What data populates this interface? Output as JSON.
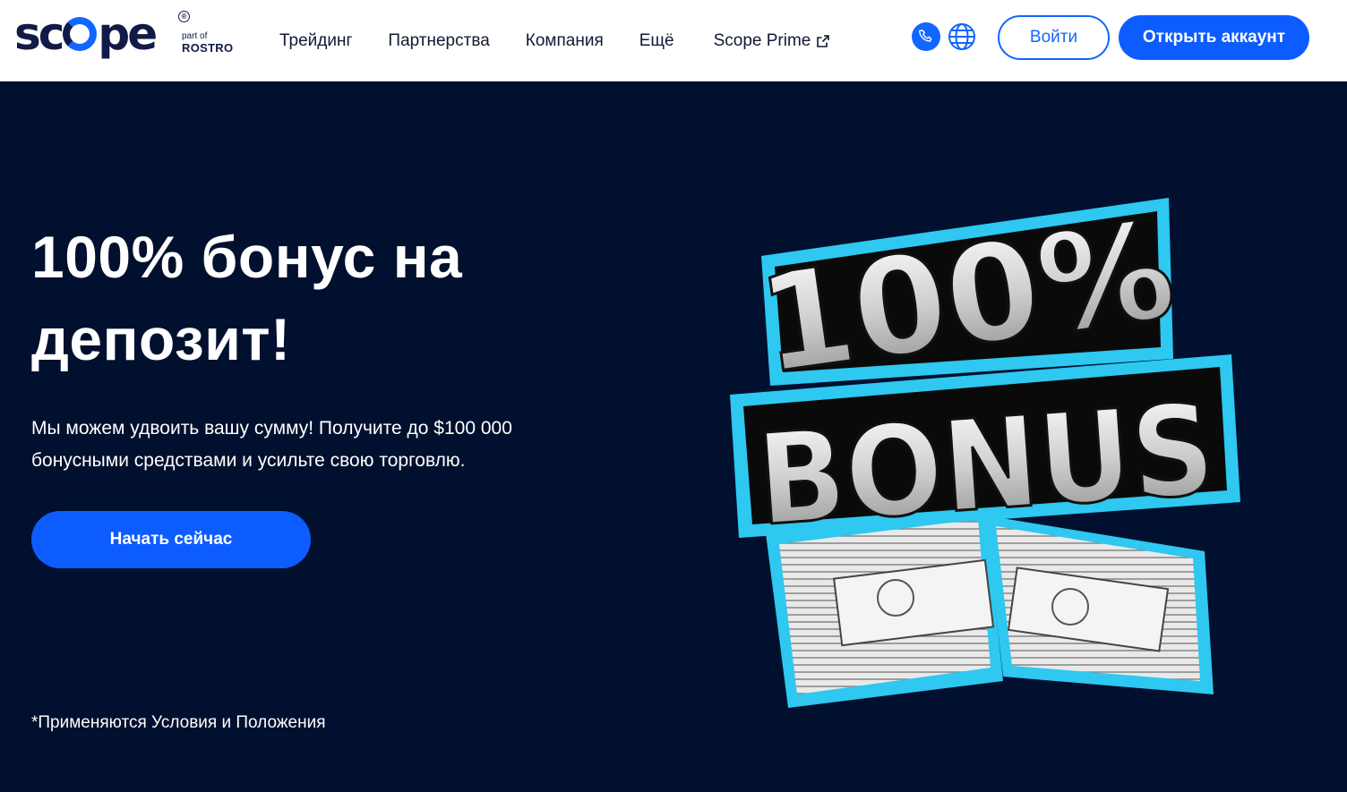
{
  "header": {
    "logo": {
      "word": "scope",
      "sub_part": "part of",
      "sub_brand": "ROSTRO",
      "reg_mark": "®"
    },
    "nav": {
      "trading": "Трейдинг",
      "partnerships": "Партнерства",
      "company": "Компания",
      "more": "Ещё",
      "scope_prime": "Scope Prime"
    },
    "icons": {
      "phone": "phone-icon",
      "globe": "globe-icon",
      "external": "external-link-icon"
    },
    "login_label": "Войти",
    "open_account_label": "Открыть аккаунт"
  },
  "hero": {
    "title_line1": "100% бонус на",
    "title_line2": "депозит!",
    "subtitle_line1": "Мы можем удвоить вашу сумму! Получите до $100 000",
    "subtitle_line2": "бонусными средствами и усильте свою торговлю.",
    "cta_label": "Начать сейчас",
    "terms_label": "*Применяются Условия и Положения",
    "promo_line1": "100%",
    "promo_line2": "BONUS"
  },
  "colors": {
    "brand_blue": "#0d5cff",
    "hero_bg": "#00102e",
    "logo_navy": "#121a48",
    "promo_outline": "#2ec8f0"
  }
}
